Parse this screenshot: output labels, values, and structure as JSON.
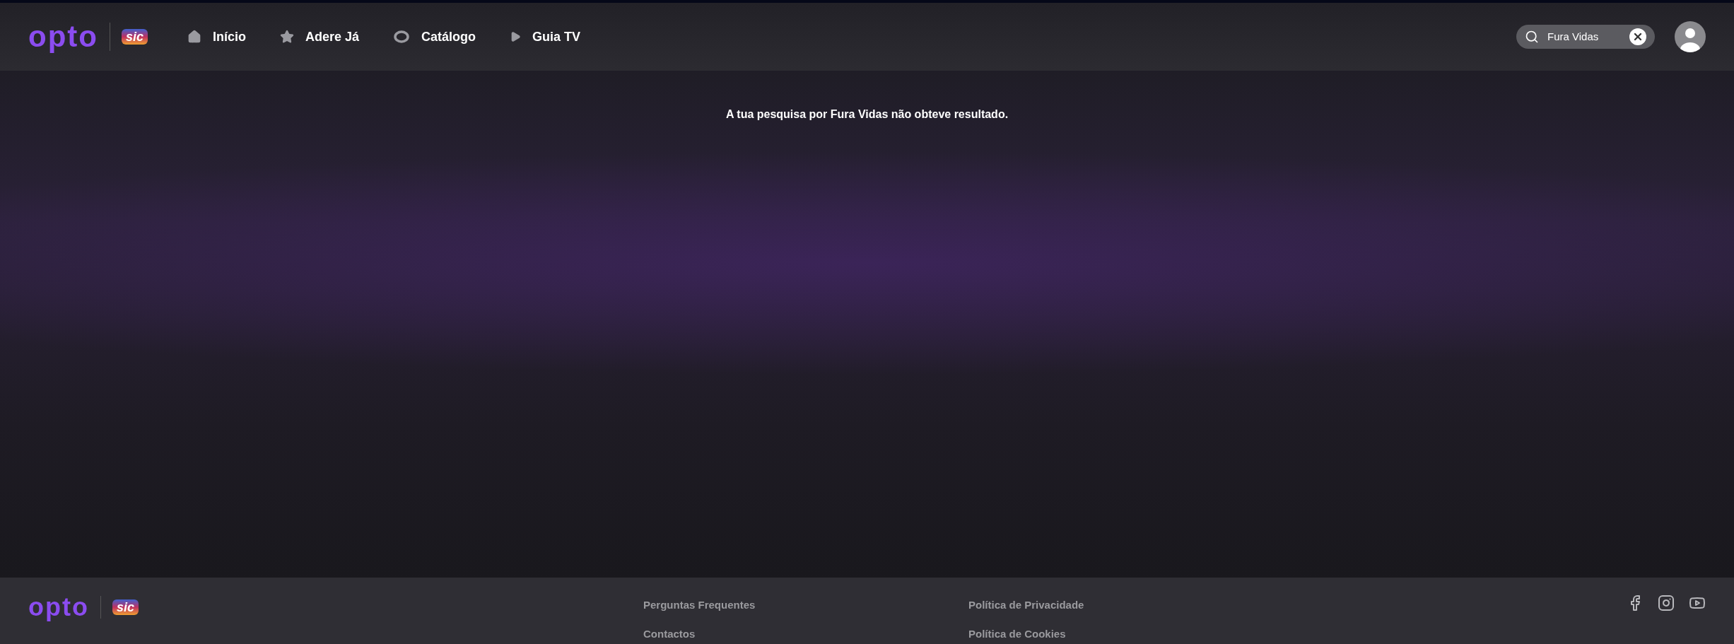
{
  "header": {
    "logo": "opto",
    "partner_logo": "sic",
    "nav": [
      {
        "label": "Início",
        "kind": "home"
      },
      {
        "label": "Adere Já",
        "kind": "star"
      },
      {
        "label": "Catálogo",
        "kind": "ring"
      },
      {
        "label": "Guia TV",
        "kind": "play"
      }
    ],
    "search": {
      "value": "Fura Vidas"
    }
  },
  "message": "A tua pesquisa por Fura Vidas não obteve resultado.",
  "footer": {
    "logo": "opto",
    "partner_logo": "sic",
    "link_columns": [
      [
        "Perguntas Frequentes",
        "Contactos"
      ],
      [
        "Política de Privacidade",
        "Política de Cookies"
      ]
    ],
    "social": [
      {
        "kind": "facebook"
      },
      {
        "kind": "instagram"
      },
      {
        "kind": "youtube"
      }
    ]
  }
}
